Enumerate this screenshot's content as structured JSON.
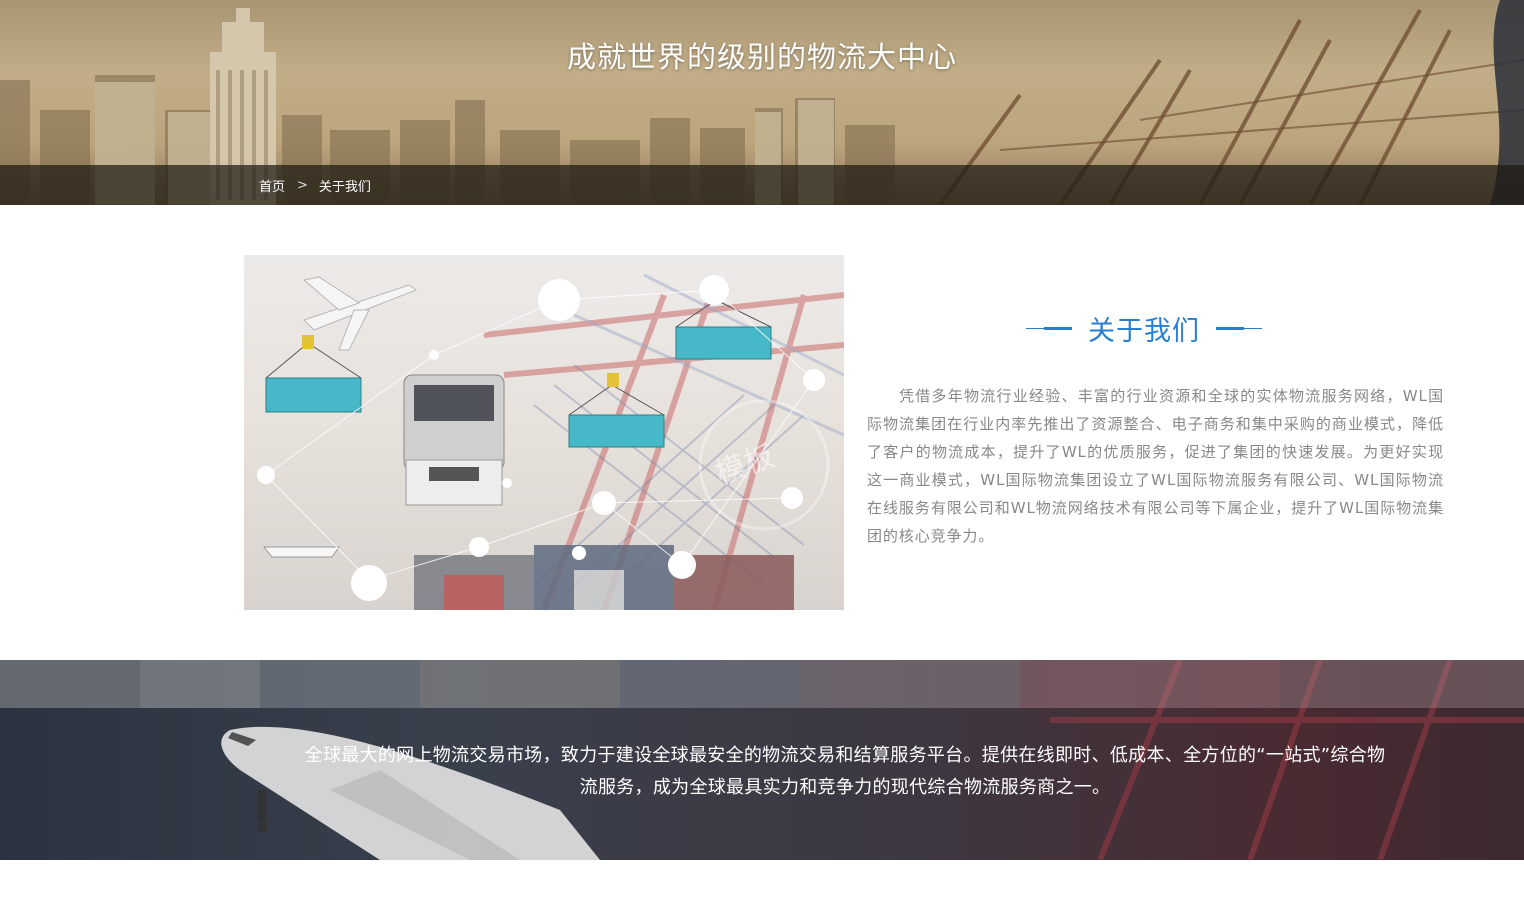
{
  "banner": {
    "title": "成就世界的级别的物流大中心"
  },
  "breadcrumb": {
    "home": "首页",
    "separator": ">",
    "current": "关于我们"
  },
  "about": {
    "heading": "关于我们",
    "paragraph": "凭借多年物流行业经验、丰富的行业资源和全球的实体物流服务网络，WL国际物流集团在行业内率先推出了资源整合、电子商务和集中采购的商业模式，降低了客户的物流成本，提升了WL的优质服务，促进了集团的快速发展。为更好实现这一商业模式，WL国际物流集团设立了WL国际物流服务有限公司、WL国际物流在线服务有限公司和WL物流网络技术有限公司等下属企业，提升了WL国际物流集团的核心竞争力。",
    "watermark": "模板"
  },
  "band": {
    "text": "全球最大的网上物流交易市场，致力于建设全球最安全的物流交易和结算服务平台。提供在线即时、低成本、全方位的“一站式”综合物流服务，成为全球最具实力和竞争力的现代综合物流服务商之一。"
  },
  "colors": {
    "accent": "#2a7fd0",
    "body_text": "#888888",
    "breadcrumb_bg": "#1e1a14"
  }
}
